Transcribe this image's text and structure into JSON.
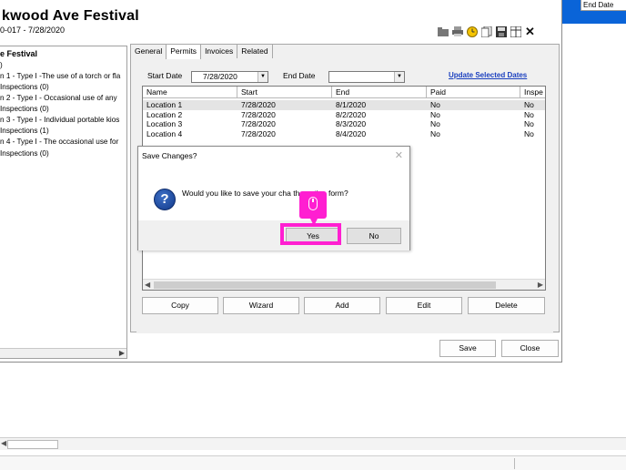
{
  "window": {
    "title": "kwood Ave Festival",
    "subtitle": "0-017  - 7/28/2020"
  },
  "right_panel": {
    "header": "End Date"
  },
  "toolbar": {
    "icons": [
      "folder-icon",
      "print-icon",
      "clock-icon",
      "copy-document-icon",
      "save-icon",
      "grid-export-icon",
      "close-icon"
    ]
  },
  "tree": {
    "items": [
      {
        "label": "e Festival",
        "bold": true
      },
      {
        "label": ")"
      },
      {
        "label": "n 1 - Type I -The use of a torch or fla"
      },
      {
        "label": "Inspections (0)"
      },
      {
        "label": "n 2 - Type I - Occasional use of any"
      },
      {
        "label": "Inspections (0)"
      },
      {
        "label": "n 3 - Type I - Individual portable kios"
      },
      {
        "label": "Inspections (1)"
      },
      {
        "label": "n 4 - Type I - The occasional use for"
      },
      {
        "label": "Inspections (0)"
      }
    ]
  },
  "tabs": [
    "General",
    "Permits",
    "Invoices",
    "Related"
  ],
  "active_tab": "Permits",
  "filters": {
    "start_label": "Start Date",
    "start_value": "7/28/2020",
    "end_label": "End Date",
    "end_value": "",
    "update_link": "Update Selected Dates"
  },
  "grid": {
    "columns": [
      "Name",
      "Start",
      "End",
      "Paid",
      "Inspe"
    ],
    "rows": [
      [
        "Location 1",
        "7/28/2020",
        "8/1/2020",
        "No",
        "No"
      ],
      [
        "Location 2",
        "7/28/2020",
        "8/2/2020",
        "No",
        "No"
      ],
      [
        "Location 3",
        "7/28/2020",
        "8/3/2020",
        "No",
        "No"
      ],
      [
        "Location 4",
        "7/28/2020",
        "8/4/2020",
        "No",
        "No"
      ]
    ]
  },
  "actions": {
    "copy": "Copy",
    "wizard": "Wizard",
    "add": "Add",
    "edit": "Edit",
    "delete": "Delete"
  },
  "footer": {
    "save": "Save",
    "close": "Close"
  },
  "dialog": {
    "title": "Save Changes?",
    "message": "Would you like to save your cha         the active form?",
    "yes": "Yes",
    "no": "No"
  },
  "highlight_color": "#ff1fd1"
}
